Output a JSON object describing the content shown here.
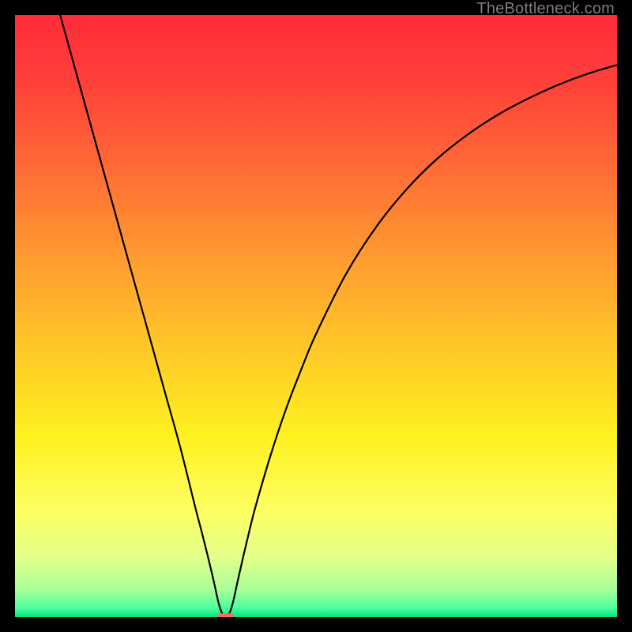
{
  "watermark": "TheBottleneck.com",
  "chart_data": {
    "type": "line",
    "title": "",
    "xlabel": "",
    "ylabel": "",
    "xlim": [
      0,
      100
    ],
    "ylim": [
      0,
      100
    ],
    "background_gradient": {
      "stops": [
        {
          "pos": 0.0,
          "color": "#ff2b3a"
        },
        {
          "pos": 0.12,
          "color": "#ff4239"
        },
        {
          "pos": 0.25,
          "color": "#ff6a36"
        },
        {
          "pos": 0.4,
          "color": "#ff9a30"
        },
        {
          "pos": 0.55,
          "color": "#ffc728"
        },
        {
          "pos": 0.7,
          "color": "#fff120"
        },
        {
          "pos": 0.82,
          "color": "#fdff60"
        },
        {
          "pos": 0.9,
          "color": "#e4ff8a"
        },
        {
          "pos": 0.955,
          "color": "#a7ff99"
        },
        {
          "pos": 0.985,
          "color": "#4cff9c"
        },
        {
          "pos": 1.0,
          "color": "#00e77e"
        }
      ]
    },
    "series": [
      {
        "name": "bottleneck-curve",
        "color": "#000000",
        "x": [
          7.5,
          10,
          12.5,
          15,
          17.5,
          20,
          22.5,
          25,
          27.5,
          30,
          31,
          32,
          33,
          33.8,
          34.4,
          35,
          35.6,
          36.2,
          37,
          38,
          39,
          40,
          42.5,
          45,
          47.5,
          50,
          55,
          60,
          65,
          70,
          75,
          80,
          85,
          90,
          95,
          100
        ],
        "y": [
          100,
          91,
          82,
          73,
          64,
          55,
          46,
          37,
          28,
          18,
          14.2,
          10.2,
          6.0,
          2.4,
          0.6,
          0.0,
          0.6,
          2.4,
          6.0,
          10.4,
          14.6,
          18.5,
          27.0,
          34.5,
          41.0,
          47.0,
          57.0,
          64.8,
          71.0,
          76.0,
          80.0,
          83.3,
          86.0,
          88.3,
          90.2,
          91.7
        ]
      }
    ],
    "marker": {
      "name": "bottleneck-marker",
      "color": "#ff6b5b",
      "x": 35,
      "y": 0,
      "width_frac": 0.028,
      "height_frac": 0.012
    }
  }
}
